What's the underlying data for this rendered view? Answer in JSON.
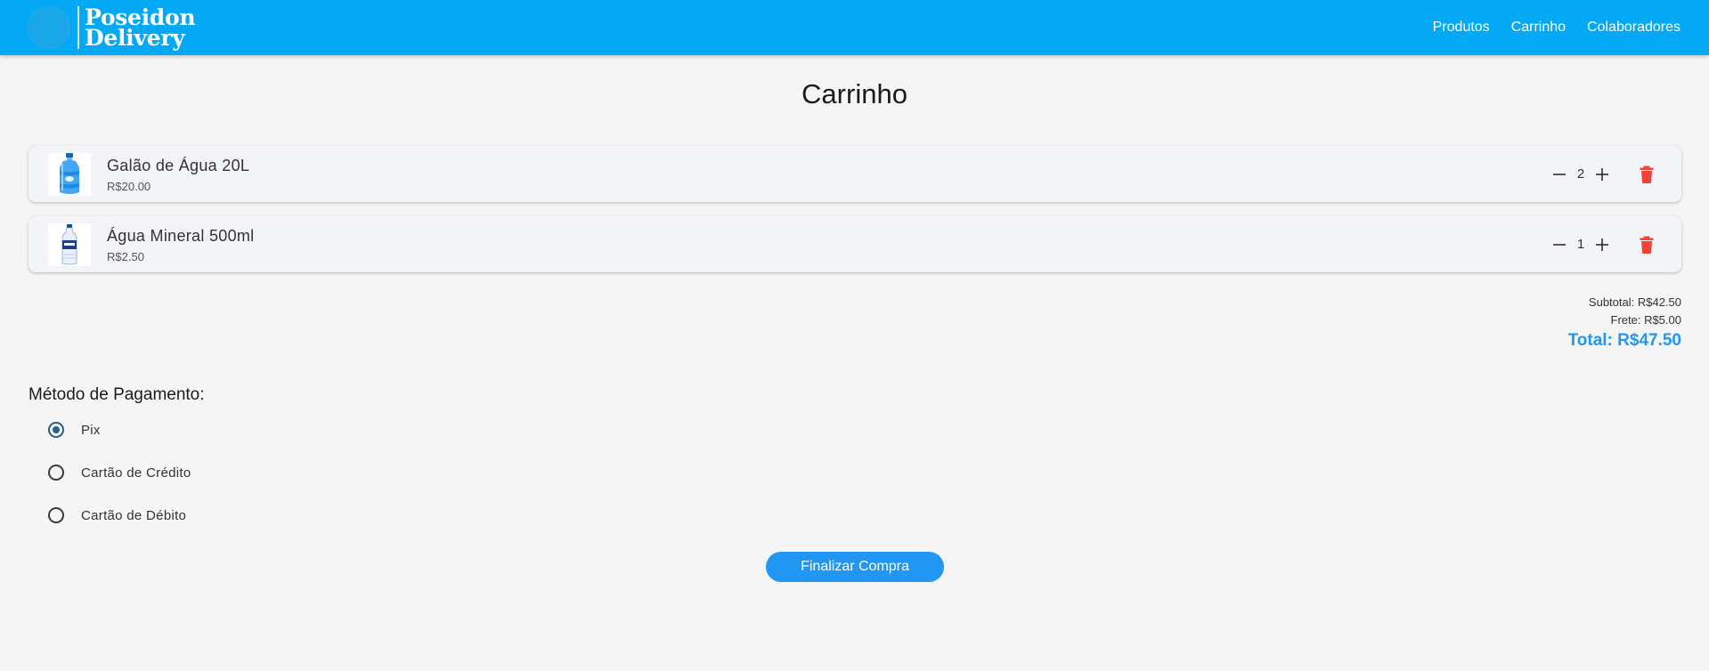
{
  "brand": {
    "line1": "Poseidon",
    "line2": "Delivery"
  },
  "nav": {
    "items": [
      {
        "label": "Produtos"
      },
      {
        "label": "Carrinho"
      },
      {
        "label": "Colaboradores"
      }
    ]
  },
  "page_title": "Carrinho",
  "cart": {
    "items": [
      {
        "name": "Galão de Água 20L",
        "price": "R$20.00",
        "quantity": "2",
        "icon": "water-jug-icon"
      },
      {
        "name": "Água Mineral 500ml",
        "price": "R$2.50",
        "quantity": "1",
        "icon": "water-bottle-icon"
      }
    ]
  },
  "totals": {
    "subtotal": "Subtotal: R$42.50",
    "frete": "Frete: R$5.00",
    "total": "Total: R$47.50"
  },
  "payment": {
    "title": "Método de Pagamento:",
    "options": [
      {
        "label": "Pix",
        "selected": true
      },
      {
        "label": "Cartão de Crédito",
        "selected": false
      },
      {
        "label": "Cartão de Débito",
        "selected": false
      }
    ]
  },
  "checkout_label": "Finalizar Compra",
  "colors": {
    "appbar": "#03a9f4",
    "primary": "#2196f3",
    "danger": "#f44336"
  }
}
